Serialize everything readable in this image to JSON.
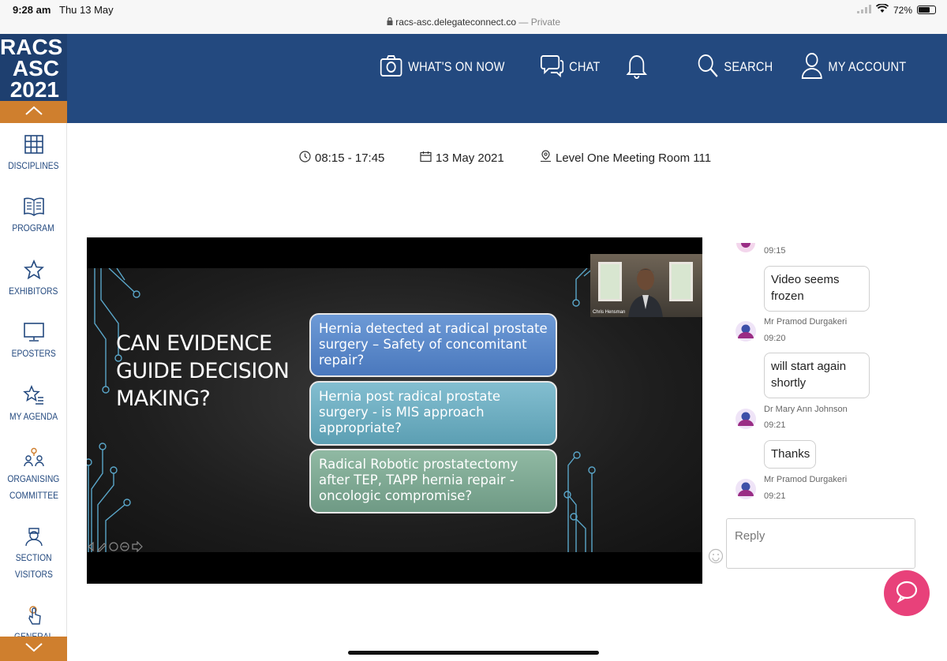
{
  "status_bar": {
    "time": "9:28 am",
    "date": "Thu 13 May",
    "url": "racs-asc.delegateconnect.co",
    "privacy": "— Private",
    "battery": "72%",
    "battery_level": 0.72
  },
  "logo": {
    "line1": "RACS",
    "line2": "ASC",
    "line3": "2021"
  },
  "nav": {
    "whats_on": "WHAT'S ON NOW",
    "chat": "CHAT",
    "search": "SEARCH",
    "account": "MY ACCOUNT"
  },
  "sidebar": {
    "items": [
      {
        "label": "DISCIPLINES",
        "icon": "grid-icon"
      },
      {
        "label": "PROGRAM",
        "icon": "book-icon"
      },
      {
        "label": "EXHIBITORS",
        "icon": "star-icon"
      },
      {
        "label": "EPOSTERS",
        "icon": "monitor-icon"
      },
      {
        "label": "MY AGENDA",
        "icon": "star-list-icon"
      },
      {
        "label": "ORGANISING",
        "label2": "COMMITTEE",
        "icon": "people-icon"
      },
      {
        "label": "SECTION",
        "label2": "VISITORS",
        "icon": "nurse-icon"
      },
      {
        "label": "GENERAL",
        "icon": "hand-icon"
      }
    ]
  },
  "session": {
    "time": "08:15 - 17:45",
    "date": "13 May 2021",
    "location": "Level One Meeting Room 111"
  },
  "slide": {
    "title_lines": [
      "CAN EVIDENCE",
      "GUIDE DECISION",
      "MAKING?"
    ],
    "boxes": [
      "Hernia detected at radical prostate surgery – Safety of concomitant repair?",
      "Hernia post radical prostate surgery -  is MIS approach appropriate?",
      "Radical Robotic prostatectomy after TEP, TAPP hernia repair - oncologic compromise?"
    ],
    "speaker_name": "Chris Hensman"
  },
  "chat": {
    "messages": [
      {
        "time": "09:15",
        "text": "Video seems frozen",
        "name": "Mr Pramod Durgakeri",
        "name_time": "09:20"
      },
      {
        "text": "will start again shortly",
        "name": "Dr Mary Ann Johnson",
        "name_time": "09:21"
      },
      {
        "text": "Thanks",
        "name": "Mr Pramod Durgakeri",
        "name_time": "09:21"
      }
    ],
    "reply_placeholder": "Reply"
  },
  "colors": {
    "header": "#23497f",
    "accent": "#cf7f2e",
    "fab": "#e8417a"
  }
}
